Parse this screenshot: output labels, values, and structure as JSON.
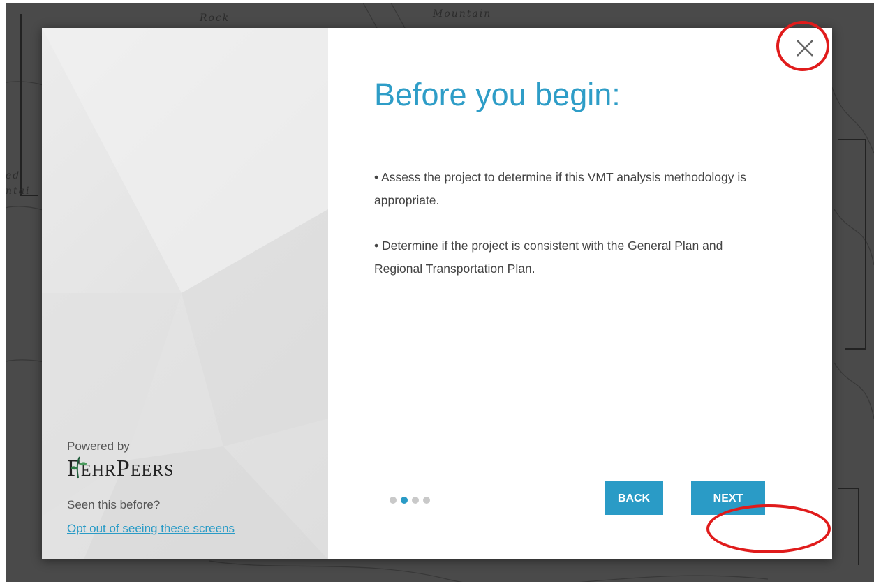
{
  "map": {
    "labels": [
      "Rock",
      "Mountain",
      "ed",
      "ntai"
    ]
  },
  "intro": {
    "powered_by": "Powered by",
    "logo_left": "Fehr",
    "logo_right": "Peers",
    "seen_before": "Seen this before?",
    "opt_out_link": "Opt out of seeing these screens",
    "title": "Before you begin:",
    "bullets": [
      "• Assess the project to determine if this VMT analysis methodology is appropriate.",
      "• Determine if the project is consistent with the General Plan and Regional Transportation Plan."
    ],
    "pager": {
      "total": 4,
      "current": 2
    },
    "back_label": "BACK",
    "next_label": "NEXT",
    "close_icon": "close-icon",
    "accent_color": "#2a9bc6",
    "highlight_color": "#e01b1b"
  }
}
